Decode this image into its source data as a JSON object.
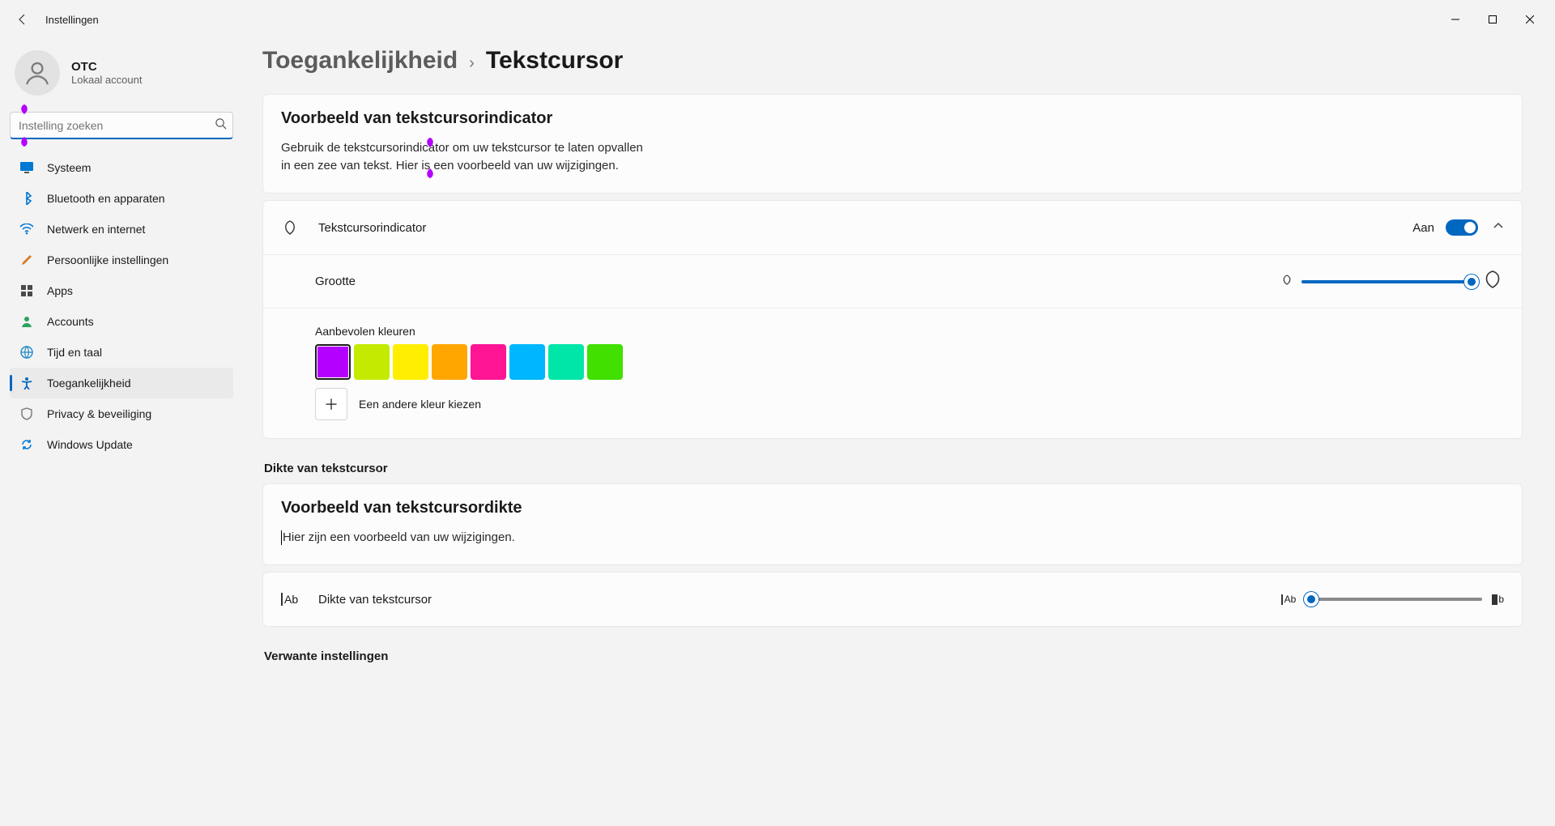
{
  "window": {
    "title": "Instellingen"
  },
  "user": {
    "name": "OTC",
    "subtitle": "Lokaal account"
  },
  "search": {
    "placeholder": "Instelling zoeken"
  },
  "nav": {
    "items": [
      {
        "label": "Systeem",
        "icon": "monitor"
      },
      {
        "label": "Bluetooth en apparaten",
        "icon": "bluetooth"
      },
      {
        "label": "Netwerk en internet",
        "icon": "wifi"
      },
      {
        "label": "Persoonlijke instellingen",
        "icon": "brush"
      },
      {
        "label": "Apps",
        "icon": "apps"
      },
      {
        "label": "Accounts",
        "icon": "person"
      },
      {
        "label": "Tijd en taal",
        "icon": "globe"
      },
      {
        "label": "Toegankelijkheid",
        "icon": "accessibility",
        "selected": true
      },
      {
        "label": "Privacy & beveiliging",
        "icon": "shield"
      },
      {
        "label": "Windows Update",
        "icon": "update"
      }
    ]
  },
  "breadcrumb": {
    "root": "Toegankelijkheid",
    "leaf": "Tekstcursor"
  },
  "preview_indicator": {
    "heading": "Voorbeeld van tekstcursorindicator",
    "text": "Gebruik de tekstcursorindicator om uw tekstcursor te laten opvallen in een zee van tekst. Hier is een voorbeeld van uw wijzigingen."
  },
  "indicator_row": {
    "label": "Tekstcursorindicator",
    "state_label": "Aan",
    "enabled": true
  },
  "size_row": {
    "label": "Grootte",
    "value": 100,
    "min": 0,
    "max": 100
  },
  "colors": {
    "label": "Aanbevolen kleuren",
    "swatches": [
      "#b400ff",
      "#c3ea00",
      "#ffee00",
      "#ffa600",
      "#ff1493",
      "#00b7ff",
      "#00e6a8",
      "#41e000"
    ],
    "selected_index": 0,
    "other_label": "Een andere kleur kiezen"
  },
  "thickness_section": "Dikte van tekstcursor",
  "preview_thickness": {
    "heading": "Voorbeeld van tekstcursordikte",
    "text": "Hier zijn een voorbeeld van uw wijzigingen."
  },
  "thickness_row": {
    "label": "Dikte van tekstcursor",
    "value": 1,
    "min": 1,
    "max": 20
  },
  "related_section": "Verwante instellingen",
  "indicator_color": "#b400ff",
  "accent": "#0067c0"
}
